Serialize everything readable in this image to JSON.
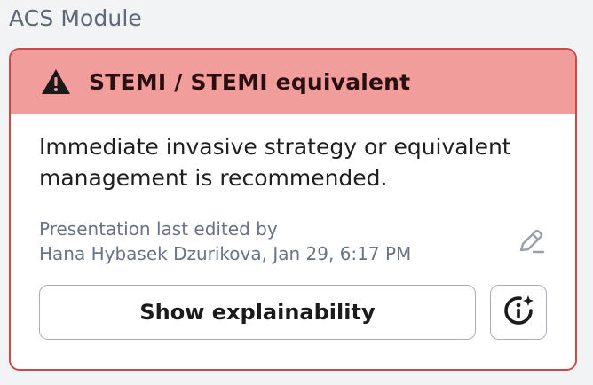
{
  "module": {
    "title": "ACS Module"
  },
  "alert": {
    "title": "STEMI / STEMI equivalent",
    "icon": "warning-triangle-icon",
    "header_color": "#f09d9b",
    "border_color": "#c94848",
    "message": "Immediate invasive strategy or equivalent management is recommended."
  },
  "meta": {
    "line1": "Presentation last edited by",
    "line2": "Hana Hybasek Dzurikova, Jan 29, 6:17 PM"
  },
  "actions": {
    "explain_label": "Show explainability",
    "edit_icon": "pencil-icon",
    "info_icon": "info-sparkle-icon"
  }
}
